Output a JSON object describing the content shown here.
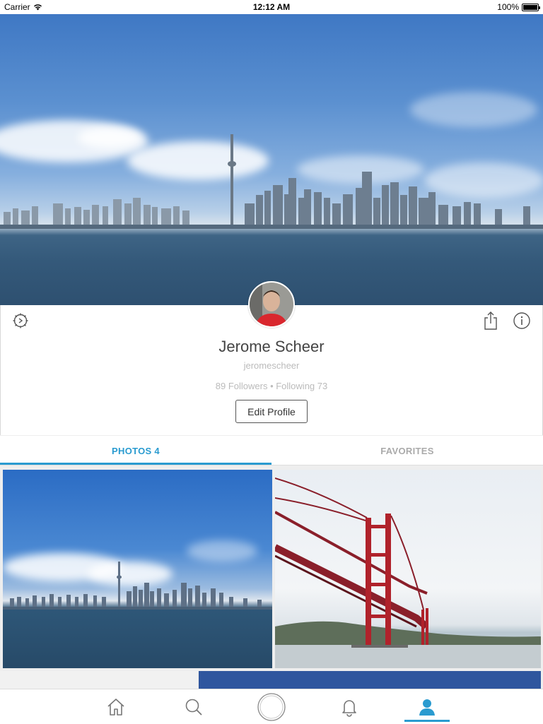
{
  "status_bar": {
    "carrier": "Carrier",
    "time": "12:12 AM",
    "battery": "100%",
    "battery_level": 1.0
  },
  "cover": {
    "icon": "cover-photo"
  },
  "profile": {
    "name": "Jerome Scheer",
    "username": "jeromescheer",
    "counts": "89 Followers • Following 73",
    "edit_label": "Edit Profile",
    "icons": {
      "settings": "settings-gear-icon",
      "share": "share-icon",
      "info": "info-icon"
    }
  },
  "tabs": [
    {
      "label": "PHOTOS 4",
      "active": true
    },
    {
      "label": "FAVORITES",
      "active": false
    }
  ],
  "photos": [
    {
      "subject": "city-skyline-photo"
    },
    {
      "subject": "bridge-photo"
    },
    {
      "subject": "photo-partial"
    },
    {
      "subject": "photo-partial"
    }
  ],
  "tab_bar": {
    "items": [
      "home-icon",
      "search-icon",
      "camera-icon",
      "notifications-icon",
      "profile-icon"
    ],
    "active": "profile-icon"
  },
  "colors": {
    "accent": "#2a9bd0",
    "avatar_shirt": "#d9272e"
  }
}
